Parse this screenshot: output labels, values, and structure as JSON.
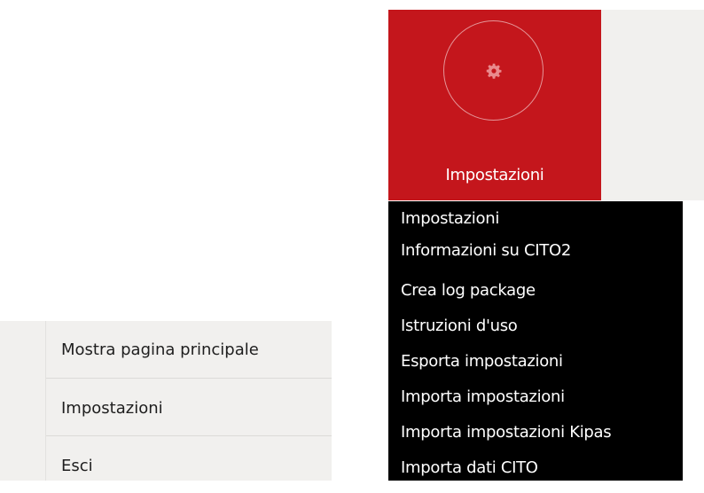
{
  "tile": {
    "label": "Impostazioni",
    "icon": "gear-icon",
    "background": "#c4161c"
  },
  "dropdown": {
    "items": [
      "Impostazioni",
      "Informazioni su CITO2",
      "Crea log package",
      "Istruzioni d'uso",
      "Esporta impostazioni",
      "Importa impostazioni",
      "Importa impostazioni Kipas",
      "Importa dati CITO"
    ]
  },
  "context_menu": {
    "items": [
      "Mostra pagina principale",
      "Impostazioni",
      "Esci"
    ]
  }
}
